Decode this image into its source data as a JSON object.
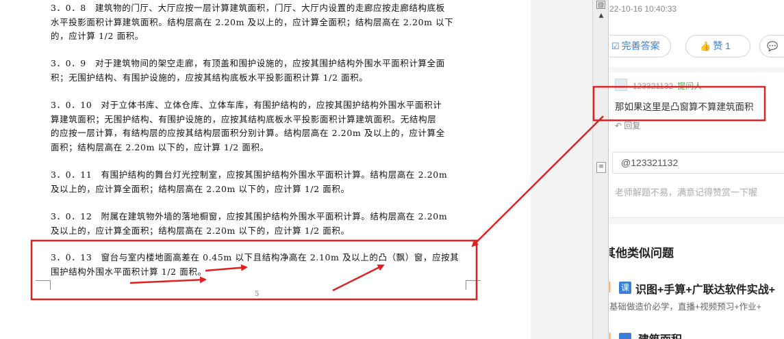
{
  "document": {
    "paragraphs": [
      {
        "lines": [
          "3．0．8　建筑物的门厅、大厅应按一层计算建筑面积，门厅、大厅内设置的走廊应按走廊结构底板",
          "水平投影面积计算建筑面积。结构层高在 2.20m 及以上的，应计算全面积；结构层高在 2.20m 以下",
          "的，应计算 1/2 面积。"
        ]
      },
      {
        "lines": [
          "3．0．9　对于建筑物间的架空走廊，有顶盖和围护设施的，应按其围护结构外围水平面积计算全面",
          "积；无围护结构、有围护设施的，应按其结构底板水平投影面积计算 1/2 面积。"
        ]
      },
      {
        "lines": [
          "3．0．10　对于立体书库、立体仓库、立体车库，有围护结构的，应按其围护结构外围水平面积计",
          "算建筑面积；无围护结构、有围护设施的，应按其结构底板水平投影面积计算建筑面积。无结构层",
          "的应按一层计算，有结构层的应按其结构层面积分别计算。结构层高在 2.20m 及以上的，应计算全",
          "面积；结构层高在 2.20m 以下的，应计算 1/2 面积。"
        ]
      },
      {
        "lines": [
          "3．0．11　有围护结构的舞台灯光控制室，应按其围护结构外围水平面积计算。结构层高在 2.20m",
          "及以上的，应计算全面积；结构层高在 2.20m 以下的，应计算 1/2 面积。"
        ]
      },
      {
        "lines": [
          "3．0．12　附属在建筑物外墙的落地橱窗，应按其围护结构外围水平面积计算。结构层高在 2.20m",
          "及以上的，应计算全面积；结构层高在 2.20m 以下的，应计算 1/2 面积。"
        ]
      },
      {
        "lines": [
          "3．0．13　窗台与室内楼地面高差在 0.45m 以下且结构净高在 2.10m 及以上的凸（飘）窗，应按其",
          "围护结构外围水平面积计算 1/2 面积。"
        ]
      }
    ],
    "page_number": "5"
  },
  "scrollbar": {
    "top_icon": "▧",
    "up_arrow": "▲",
    "thumb_icon": "≡"
  },
  "panel": {
    "timestamp": "22-10-16 10:40:33",
    "buttons": {
      "improve": {
        "icon": "edit-icon",
        "glyph": "☑",
        "label": "完善答案"
      },
      "like": {
        "icon": "thumbs-up-icon",
        "glyph": "👍",
        "label": "赞 1"
      },
      "comment": {
        "icon": "comment-icon",
        "glyph": "💬",
        "label": ""
      }
    },
    "comment": {
      "user": "123321132",
      "role": "提问人",
      "text": "那如果这里是凸窗算不算建筑面积",
      "reply_label": "回复",
      "reply_icon": "↶"
    },
    "reply_input": {
      "value": "@123321132"
    },
    "hint": "老师解题不易，满意记得赞赏一下喔",
    "similar": {
      "title": "其他类似问题",
      "course": {
        "tag": "课",
        "title": "识图+手算+广联达软件实战+",
        "subtitle": "基础做造价必学，直播+视频预习+作业+"
      },
      "next_title": "建筑面积"
    }
  },
  "colors": {
    "annotation": "#e02020",
    "link": "#3b7fd4",
    "accent": "#f08a2a"
  }
}
